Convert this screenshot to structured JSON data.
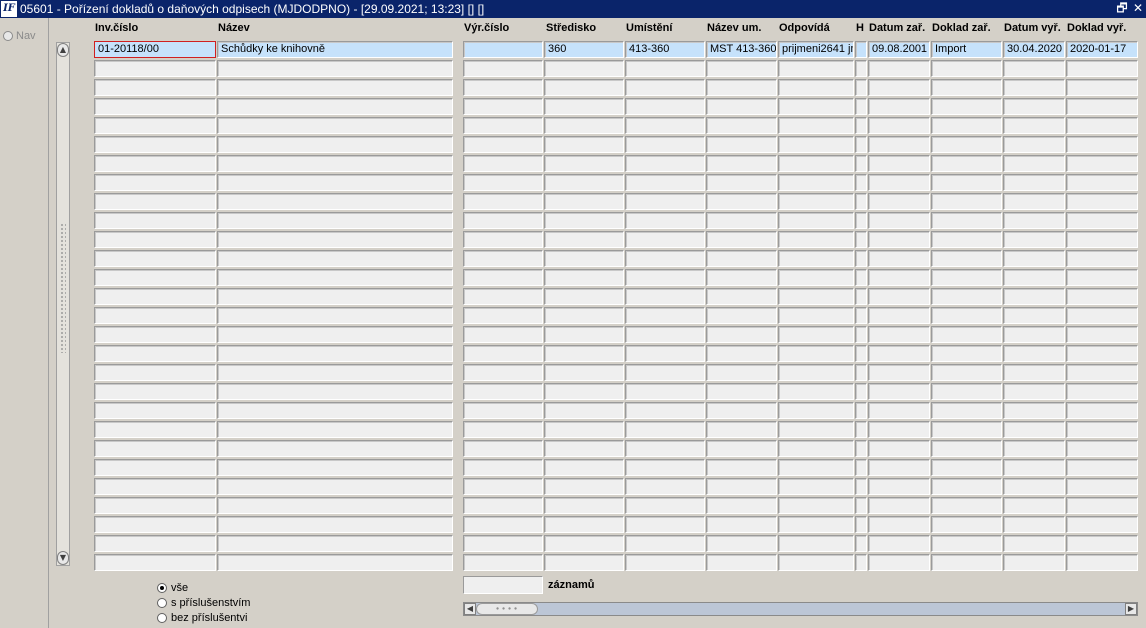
{
  "window": {
    "logo": "IF",
    "title": "05601 - Pořízení dokladů o daňových odpisech (MJDODPNO) - [29.09.2021; 13:23]  []  []",
    "restore_glyph": "🗗",
    "close_glyph": "✕"
  },
  "nav": {
    "label": "Nav"
  },
  "columns": [
    "Inv.číslo",
    "Název",
    "Výr.číslo",
    "Středisko",
    "Umístění",
    "Název um.",
    "Odpovídá",
    "H",
    "Datum zař.",
    "Doklad zař.",
    "Datum vyř.",
    "Doklad vyř."
  ],
  "rows": [
    [
      "01-20118/00",
      "Schůdky ke knihovně",
      "",
      "360",
      "413-360",
      "MST 413-360",
      "prijmeni2641 jm",
      "",
      "09.08.2001",
      "Import",
      "30.04.2020",
      "2020-01-17"
    ]
  ],
  "footer": {
    "filter_options": [
      {
        "label": "vše",
        "checked": true
      },
      {
        "label": "s příslušenstvím",
        "checked": false
      },
      {
        "label": "bez příslušentvi",
        "checked": false
      }
    ],
    "record_count": "",
    "record_count_label": "záznamů"
  }
}
